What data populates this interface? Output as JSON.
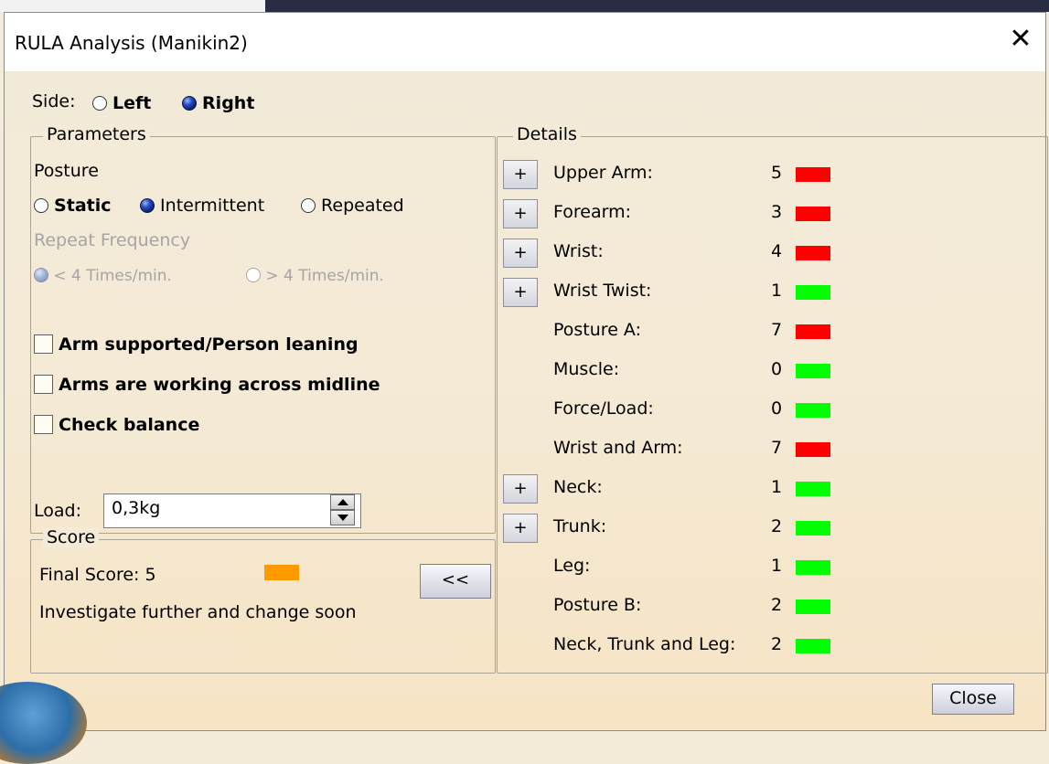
{
  "window": {
    "title": "RULA Analysis (Manikin2)",
    "close_glyph": "✕"
  },
  "side": {
    "label": "Side:",
    "options": [
      {
        "label": "Left",
        "selected": false
      },
      {
        "label": "Right",
        "selected": true
      }
    ]
  },
  "parameters": {
    "legend": "Parameters",
    "posture_label": "Posture",
    "posture_options": [
      {
        "label": "Static",
        "selected": false
      },
      {
        "label": "Intermittent",
        "selected": true
      },
      {
        "label": "Repeated",
        "selected": false
      }
    ],
    "repeat_frequency_label": "Repeat Frequency",
    "repeat_options": [
      {
        "label": "< 4 Times/min.",
        "selected": true,
        "enabled": false
      },
      {
        "label": "> 4 Times/min.",
        "selected": false,
        "enabled": false
      }
    ],
    "checkboxes": [
      {
        "label": "Arm supported/Person leaning",
        "checked": false
      },
      {
        "label": "Arms are working across midline",
        "checked": false
      },
      {
        "label": "Check balance",
        "checked": false
      }
    ],
    "load_label": "Load:",
    "load_value": "0,3kg"
  },
  "score": {
    "legend": "Score",
    "final_score_text": "Final Score: 5",
    "final_color": "#ff9900",
    "message": "Investigate further and change soon",
    "collapse_label": "<<"
  },
  "details": {
    "legend": "Details",
    "expand_label": "+",
    "rows": [
      {
        "label": "Upper Arm:",
        "value": "5",
        "color": "#ff0000",
        "expandable": true
      },
      {
        "label": "Forearm:",
        "value": "3",
        "color": "#ff0000",
        "expandable": true
      },
      {
        "label": "Wrist:",
        "value": "4",
        "color": "#ff0000",
        "expandable": true
      },
      {
        "label": "Wrist Twist:",
        "value": "1",
        "color": "#00ff00",
        "expandable": true
      },
      {
        "label": "Posture A:",
        "value": "7",
        "color": "#ff0000",
        "expandable": false
      },
      {
        "label": "Muscle:",
        "value": "0",
        "color": "#00ff00",
        "expandable": false
      },
      {
        "label": "Force/Load:",
        "value": "0",
        "color": "#00ff00",
        "expandable": false
      },
      {
        "label": "Wrist and Arm:",
        "value": "7",
        "color": "#ff0000",
        "expandable": false
      },
      {
        "label": "Neck:",
        "value": "1",
        "color": "#00ff00",
        "expandable": true
      },
      {
        "label": "Trunk:",
        "value": "2",
        "color": "#00ff00",
        "expandable": true
      },
      {
        "label": "Leg:",
        "value": "1",
        "color": "#00ff00",
        "expandable": false
      },
      {
        "label": "Posture B:",
        "value": "2",
        "color": "#00ff00",
        "expandable": false
      },
      {
        "label": "Neck, Trunk and Leg:",
        "value": "2",
        "color": "#00ff00",
        "expandable": false
      }
    ]
  },
  "footer": {
    "close_label": "Close"
  }
}
